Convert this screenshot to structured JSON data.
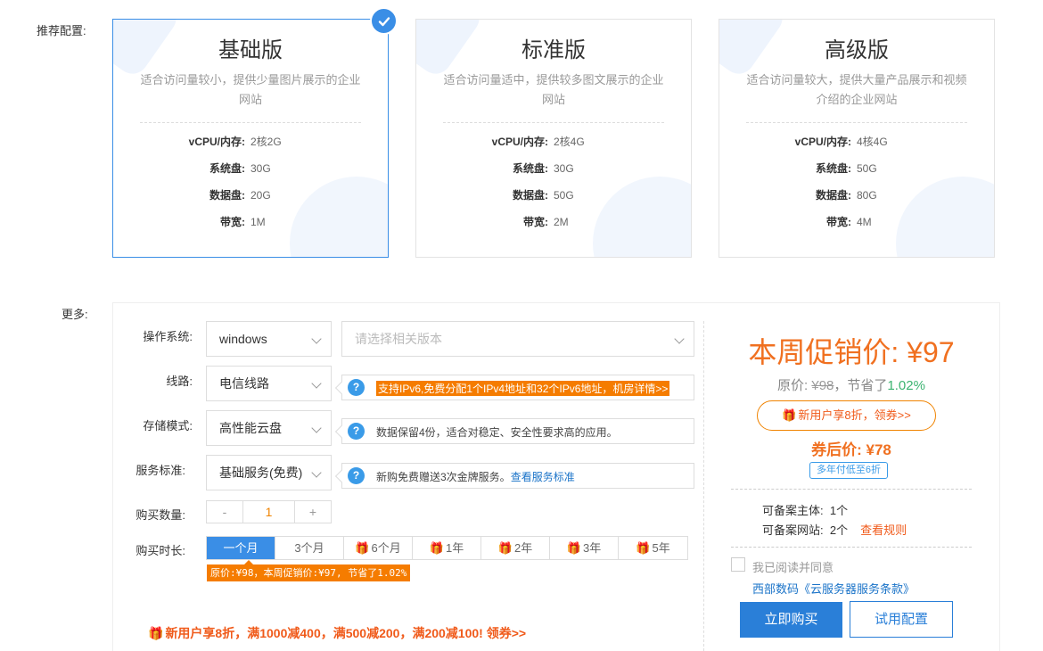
{
  "labels": {
    "recommended": "推荐配置:",
    "more": "更多:"
  },
  "plans": [
    {
      "name": "基础版",
      "desc": "适合访问量较小，提供少量图片展示的企业网站",
      "specs": [
        {
          "k": "vCPU/内存:",
          "v": "2核2G"
        },
        {
          "k": "系统盘:",
          "v": "30G"
        },
        {
          "k": "数据盘:",
          "v": "20G"
        },
        {
          "k": "带宽:",
          "v": "1M"
        }
      ],
      "selected": true
    },
    {
      "name": "标准版",
      "desc": "适合访问量适中，提供较多图文展示的企业网站",
      "specs": [
        {
          "k": "vCPU/内存:",
          "v": "2核4G"
        },
        {
          "k": "系统盘:",
          "v": "30G"
        },
        {
          "k": "数据盘:",
          "v": "50G"
        },
        {
          "k": "带宽:",
          "v": "2M"
        }
      ],
      "selected": false
    },
    {
      "name": "高级版",
      "desc": "适合访问量较大，提供大量产品展示和视频介绍的企业网站",
      "specs": [
        {
          "k": "vCPU/内存:",
          "v": "4核4G"
        },
        {
          "k": "系统盘:",
          "v": "50G"
        },
        {
          "k": "数据盘:",
          "v": "80G"
        },
        {
          "k": "带宽:",
          "v": "4M"
        }
      ],
      "selected": false
    }
  ],
  "form": {
    "os_label": "操作系统:",
    "os_value": "windows",
    "os_version_placeholder": "请选择相关版本",
    "line_label": "线路:",
    "line_value": "电信线路",
    "line_tip": "支持IPv6,免费分配1个IPv4地址和32个IPv6地址，机房详情>>",
    "storage_label": "存储模式:",
    "storage_value": "高性能云盘",
    "storage_tip": "数据保留4份，适合对稳定、安全性要求高的应用。",
    "service_label": "服务标准:",
    "service_value": "基础服务(免费)",
    "service_tip": "新购免费赠送3次金牌服务。",
    "service_tip_link": "查看服务标准",
    "qty_label": "购买数量:",
    "qty_minus": "-",
    "qty_value": "1",
    "qty_plus": "+",
    "duration_label": "购买时长:",
    "durations": [
      "一个月",
      "3个月",
      "6个月",
      "1年",
      "2年",
      "3年",
      "5年"
    ],
    "duration_note": "原价:¥98，本周促销价:¥97, 节省了1.02%",
    "promo": "新用户享8折，满1000减400，满500减200，满200减100! 领券>>"
  },
  "pricing": {
    "title": "本周促销价: ¥97",
    "orig_label": "原价: ",
    "orig_value": "¥98",
    "save_label": "，节省了",
    "save_value": "1.02%",
    "newuser_btn": "新用户享8折，领券>>",
    "coupon": "券后价: ¥78",
    "multi_year": "多年付低至6折",
    "icp_subject_label": "可备案主体:",
    "icp_subject_value": "1个",
    "icp_site_label": "可备案网站:",
    "icp_site_value": "2个",
    "rules_link": "查看规则",
    "agree": "我已阅读并同意",
    "terms": "西部数码《云服务器服务条款》",
    "buy": "立即购买",
    "try": "试用配置"
  },
  "colors": {
    "accent_blue": "#3a8ee6",
    "promo_orange": "#f07020",
    "save_green": "#3cb371"
  }
}
